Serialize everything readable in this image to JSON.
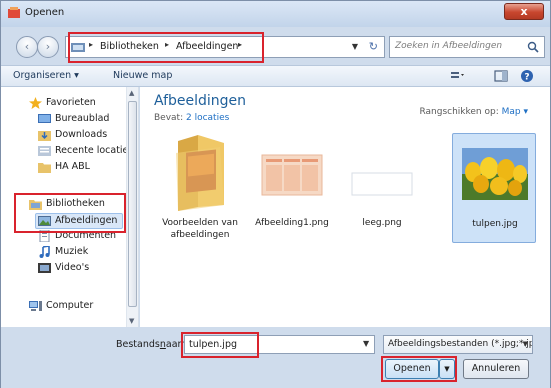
{
  "window": {
    "title": "Openen",
    "close_label": "x"
  },
  "nav": {
    "back_label": "‹",
    "forward_label": "›",
    "address": {
      "crumbs": [
        "Bibliotheken",
        "Afbeeldingen"
      ],
      "separator": "▸"
    },
    "search": {
      "placeholder": "Zoeken in Afbeeldingen"
    }
  },
  "toolbar": {
    "organize": "Organiseren ▾",
    "new_folder": "Nieuwe map"
  },
  "sidebar": {
    "favorites": {
      "label": "Favorieten",
      "items": [
        "Bureaublad",
        "Downloads",
        "Recente locaties",
        "HA ABL"
      ]
    },
    "libraries": {
      "label": "Bibliotheken",
      "items": [
        "Afbeeldingen",
        "Documenten",
        "Muziek",
        "Video's"
      ]
    },
    "computer": {
      "label": "Computer"
    }
  },
  "content": {
    "title": "Afbeeldingen",
    "subtitle_prefix": "Bevat:",
    "subtitle_link": "2 locaties",
    "arrange_label": "Rangschikken op:",
    "arrange_value": "Map ▾",
    "files": [
      {
        "name": "Voorbeelden van afbeeldingen",
        "kind": "folder"
      },
      {
        "name": "Afbeelding1.png",
        "kind": "document"
      },
      {
        "name": "leeg.png",
        "kind": "blank"
      },
      {
        "name": "tulpen.jpg",
        "kind": "photo"
      }
    ]
  },
  "footer": {
    "filename_label_pre": "Bestands",
    "filename_label_ul": "n",
    "filename_label_post": "aam:",
    "filename_value": "tulpen.jpg",
    "filetype_value": "Afbeeldingsbestanden (*.jpg;*.jpeg",
    "open_label": "Openen",
    "cancel_label": "Annuleren"
  },
  "colors": {
    "highlight": "#d9232d",
    "accent": "#1e5f9a",
    "link": "#1e6fc4"
  }
}
